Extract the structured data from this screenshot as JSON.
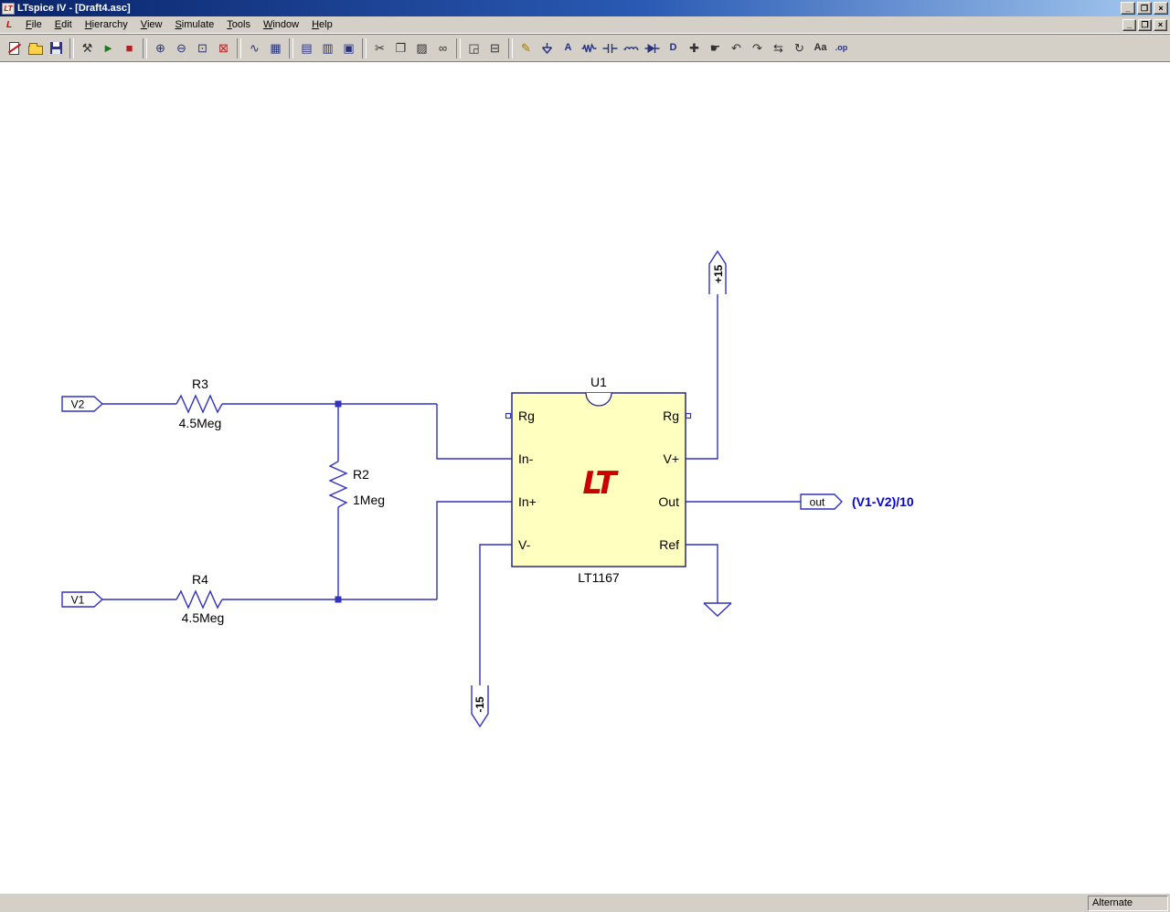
{
  "window": {
    "title": "LTspice IV - [Draft4.asc]",
    "controls": {
      "minimize": "_",
      "restore": "❐",
      "close": "×"
    },
    "mdi_controls": {
      "minimize": "_",
      "restore": "❐",
      "close": "×"
    }
  },
  "menu": {
    "items": [
      "File",
      "Edit",
      "Hierarchy",
      "View",
      "Simulate",
      "Tools",
      "Window",
      "Help"
    ]
  },
  "toolbar": {
    "buttons": [
      {
        "name": "new-schematic",
        "glyph": ""
      },
      {
        "name": "open-file",
        "glyph": ""
      },
      {
        "name": "save",
        "glyph": ""
      },
      {
        "name": "control-panel",
        "glyph": "⚒"
      },
      {
        "name": "run-simulation",
        "glyph": "►"
      },
      {
        "name": "halt-simulation",
        "glyph": "■"
      },
      {
        "name": "zoom-area",
        "glyph": "⊕"
      },
      {
        "name": "zoom-back",
        "glyph": "⊖"
      },
      {
        "name": "zoom-full-extents",
        "glyph": "⊡"
      },
      {
        "name": "zoom-fit",
        "glyph": "⊠"
      },
      {
        "name": "autorange-y-axis",
        "glyph": "∿"
      },
      {
        "name": "grid",
        "glyph": "▦"
      },
      {
        "name": "tile-horizontally",
        "glyph": "▤"
      },
      {
        "name": "tile-vertically",
        "glyph": "▥"
      },
      {
        "name": "cascade-windows",
        "glyph": "▣"
      },
      {
        "name": "cut",
        "glyph": "✂"
      },
      {
        "name": "copy",
        "glyph": "❐"
      },
      {
        "name": "paste",
        "glyph": "▨"
      },
      {
        "name": "find",
        "glyph": "∞"
      },
      {
        "name": "print-preview",
        "glyph": "◲"
      },
      {
        "name": "print",
        "glyph": "⊟"
      },
      {
        "name": "draw-wire",
        "glyph": "✎"
      },
      {
        "name": "place-ground",
        "glyph": ""
      },
      {
        "name": "label-net",
        "glyph": "A"
      },
      {
        "name": "place-resistor",
        "glyph": ""
      },
      {
        "name": "place-capacitor",
        "glyph": ""
      },
      {
        "name": "place-inductor",
        "glyph": ""
      },
      {
        "name": "place-diode",
        "glyph": ""
      },
      {
        "name": "place-component",
        "glyph": "D"
      },
      {
        "name": "move",
        "glyph": "✚"
      },
      {
        "name": "drag",
        "glyph": "☛"
      },
      {
        "name": "undo",
        "glyph": "↶"
      },
      {
        "name": "redo",
        "glyph": "↷"
      },
      {
        "name": "mirror",
        "glyph": "⇆"
      },
      {
        "name": "rotate",
        "glyph": "↻"
      },
      {
        "name": "place-text",
        "glyph": "Aa"
      },
      {
        "name": "spice-directive",
        "glyph": ".op"
      }
    ]
  },
  "statusbar": {
    "message": "",
    "mode": "Alternate"
  },
  "colors": {
    "titlebar_from": "#0a246a",
    "titlebar_to": "#a6caf0",
    "chrome": "#d4d0c8",
    "canvas_background": "#ffffff",
    "wire": "#3232c0",
    "component_fill": "#ffffc0",
    "logo_red": "#cc0000",
    "annotation_blue": "#0202dd"
  },
  "schematic": {
    "ports": {
      "v2": "V2",
      "v1": "V1",
      "out": "out"
    },
    "resistors": {
      "r3": {
        "ref": "R3",
        "value": "4.5Meg"
      },
      "r2": {
        "ref": "R2",
        "value": "1Meg"
      },
      "r4": {
        "ref": "R4",
        "value": "4.5Meg"
      }
    },
    "ic": {
      "ref": "U1",
      "part": "LT1167",
      "logo": "LT",
      "pins": {
        "rg_left": "Rg",
        "in_minus": "In-",
        "in_plus": "In+",
        "v_minus": "V-",
        "rg_right": "Rg",
        "v_plus": "V+",
        "out": "Out",
        "ref": "Ref"
      }
    },
    "supplies": {
      "positive": "+15",
      "negative": "-15"
    },
    "annotation": "(V1-V2)/10"
  }
}
